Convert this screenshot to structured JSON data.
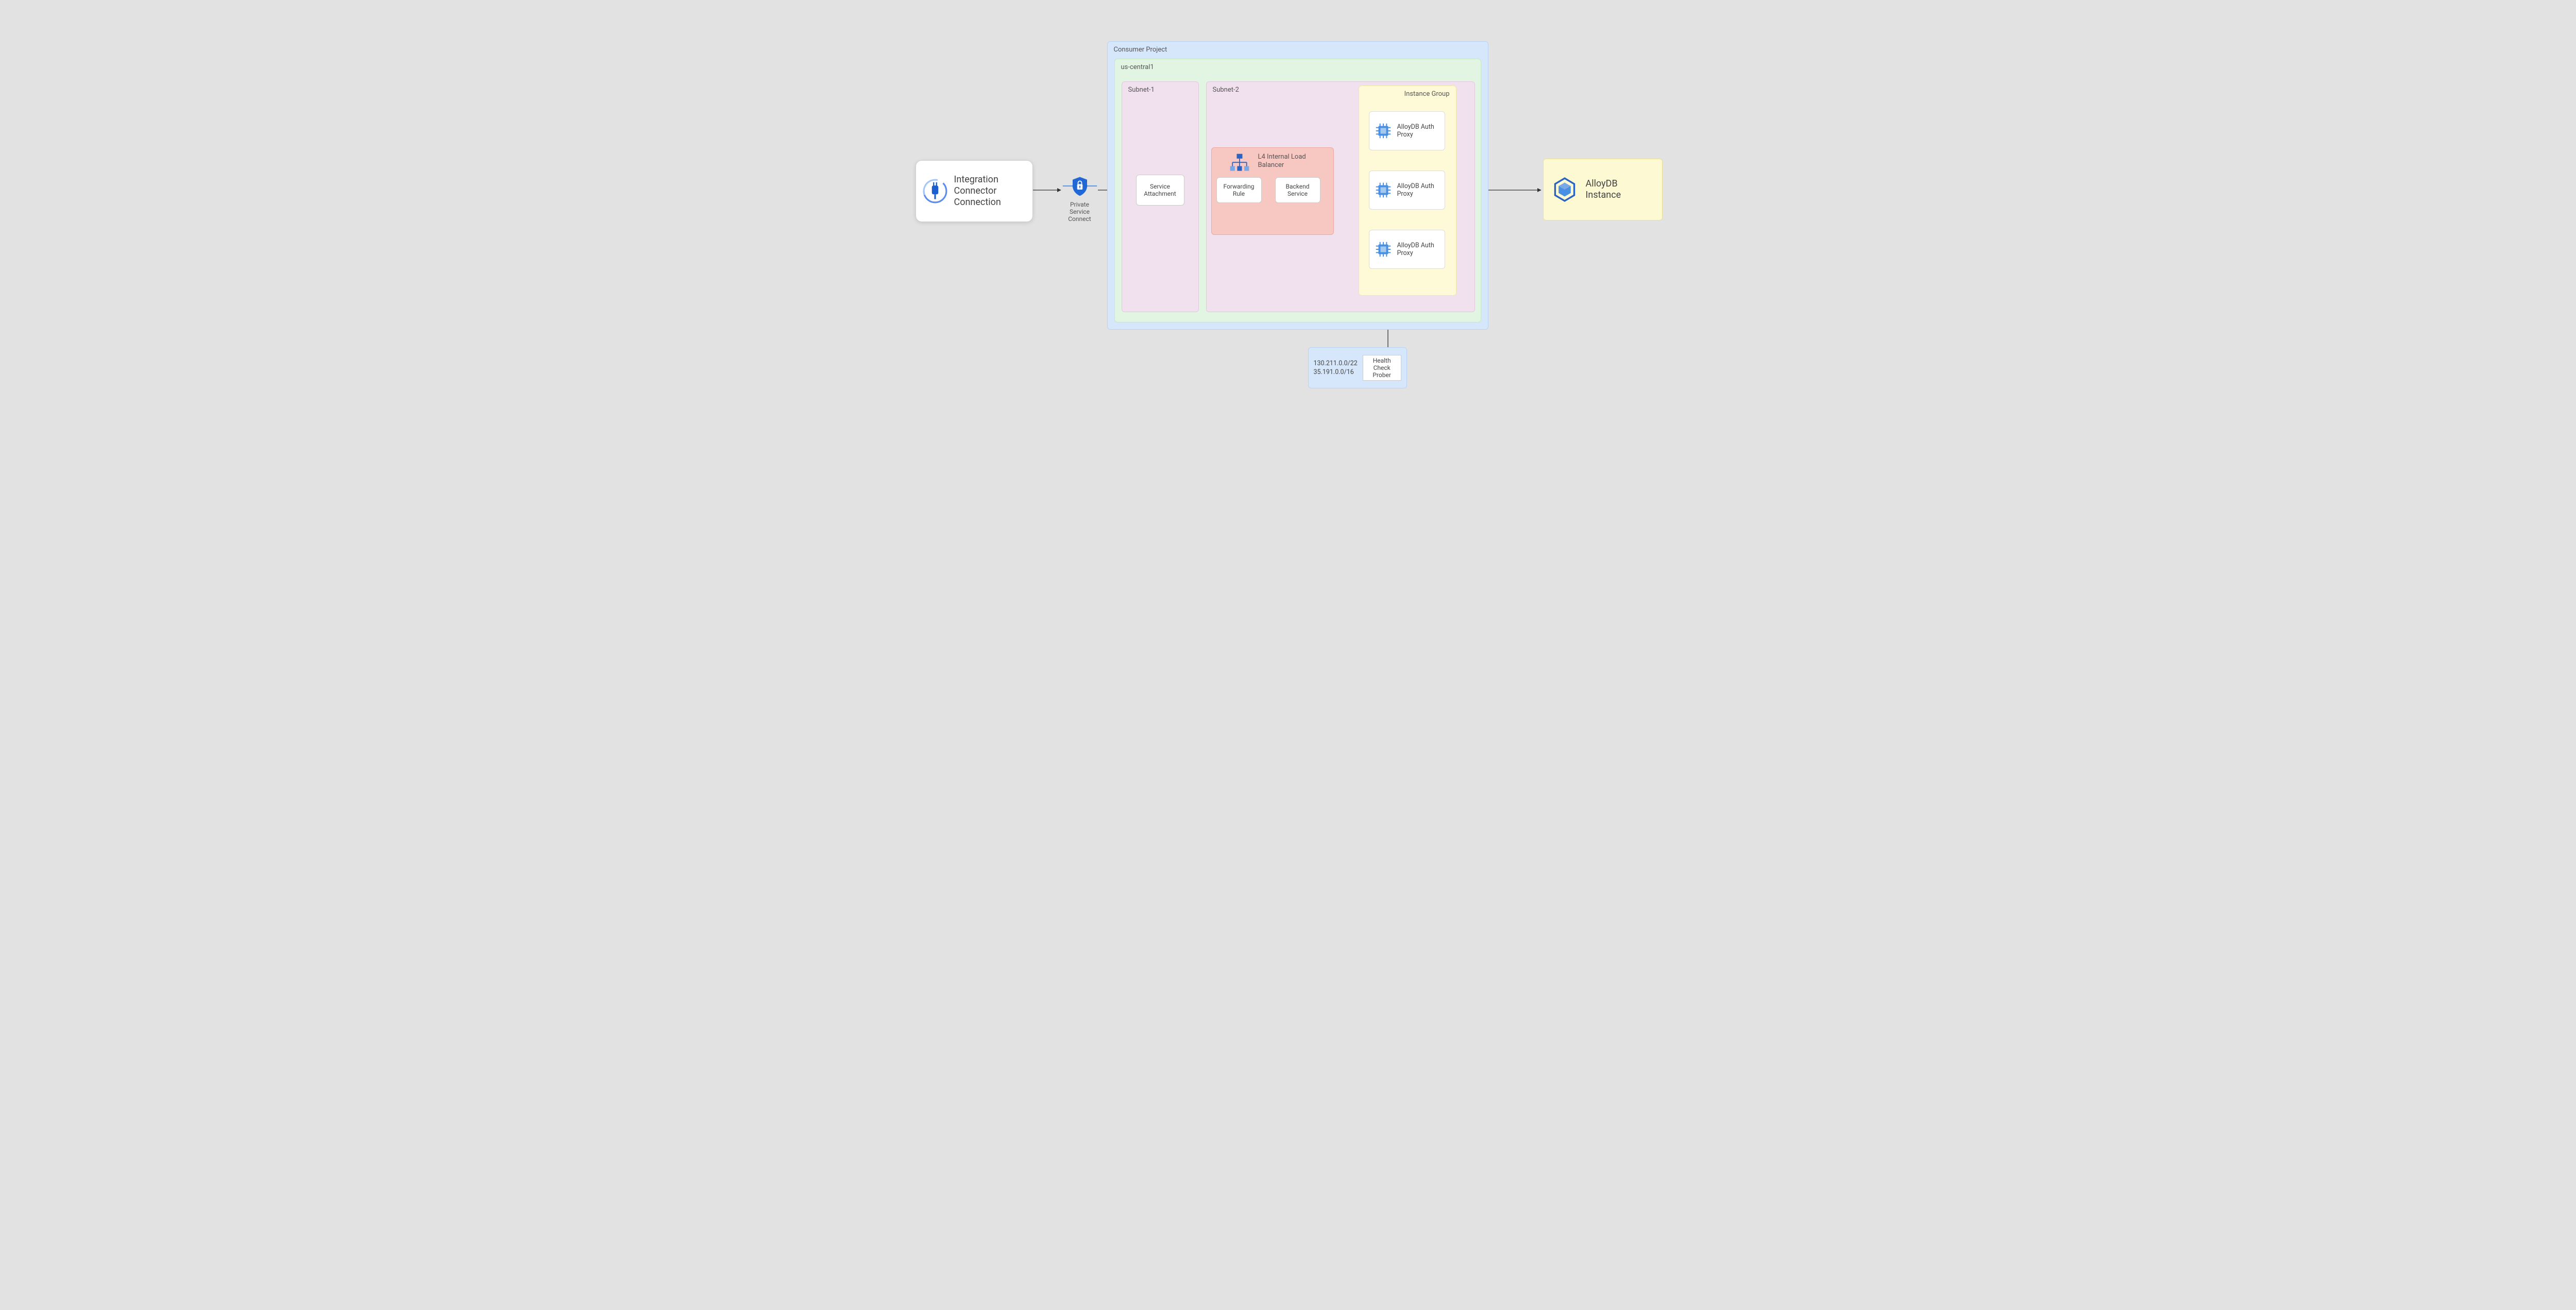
{
  "integration": {
    "title": "Integration Connector Connection"
  },
  "psc": {
    "label": "Private Service Connect"
  },
  "consumer_project": {
    "label": "Consumer Project"
  },
  "region": {
    "label": "us-central1"
  },
  "subnet1": {
    "label": "Subnet-1"
  },
  "subnet2": {
    "label": "Subnet-2"
  },
  "service_attachment": {
    "label": "Service Attachment"
  },
  "load_balancer": {
    "title": "L4 Internal Load Balancer",
    "forwarding_rule": "Forwarding Rule",
    "backend_service": "Backend Service"
  },
  "instance_group": {
    "label": "Instance Group",
    "proxies": [
      {
        "label": "AlloyDB Auth Proxy"
      },
      {
        "label": "AlloyDB Auth Proxy"
      },
      {
        "label": "AlloyDB Auth Proxy"
      }
    ]
  },
  "alloydb": {
    "title": "AlloyDB Instance"
  },
  "health_check": {
    "cidrs": "130.211.0.0/22\n35.191.0.0/16",
    "prober": "Health Check Prober"
  }
}
